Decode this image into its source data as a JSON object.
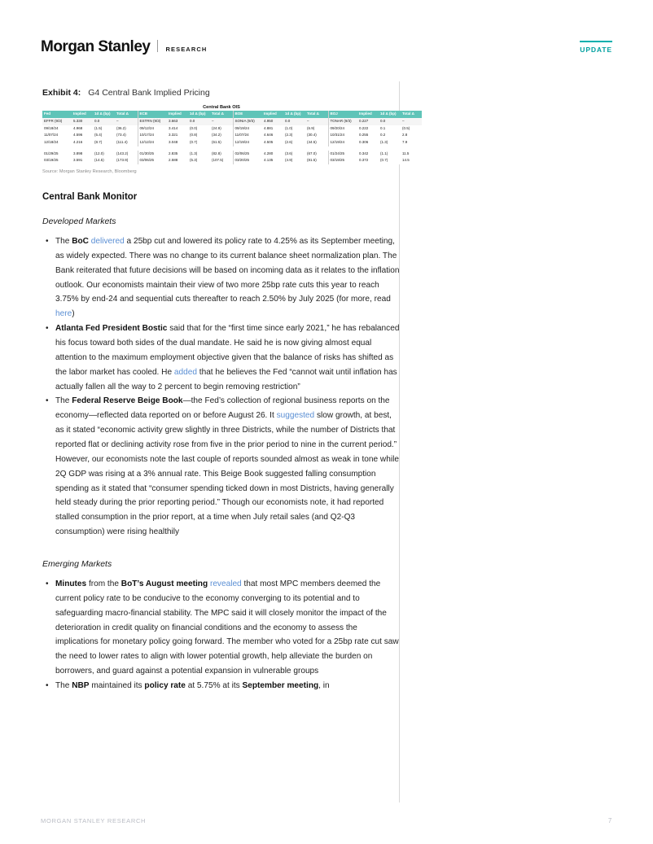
{
  "header": {
    "brand_name": "Morgan Stanley",
    "brand_sub": "RESEARCH",
    "update_badge": "UPDATE",
    "accent_color": "#00b0ae"
  },
  "exhibit": {
    "label": "Exhibit 4:",
    "title": "G4 Central Bank Implied Pricing",
    "table_supertitle": "Central Bank OIS",
    "source": "Source: Morgan Stanley Research, Bloomberg",
    "headers": [
      "Fed",
      "Implied",
      "1d Δ (bp)",
      "Total Δ",
      "ECB",
      "Implied",
      "1d Δ (bp)",
      "Total Δ",
      "BOE",
      "Implied",
      "1d Δ (bp)",
      "Total Δ",
      "BOJ",
      "Implied",
      "1d Δ (bp)",
      "Total Δ"
    ],
    "rows": [
      {
        "shade": true,
        "cells": [
          "EFFR (9/3)",
          "5.330",
          "0.0",
          "–",
          "ESTRN (9/3)",
          "3.663",
          "0.0",
          "–",
          "SONIA (9/3)",
          "4.950",
          "0.0",
          "–",
          "TONAR (9/3)",
          "0.227",
          "0.0",
          "–"
        ],
        "neg": [
          false,
          false,
          false,
          false,
          false,
          false,
          false,
          false,
          false,
          false,
          false,
          false,
          false,
          false,
          false,
          false
        ]
      },
      {
        "shade": false,
        "cells": [
          "09/18/24",
          "4.968",
          "(1.5)",
          "(36.2)",
          "09/12/24",
          "3.414",
          "(0.0)",
          "(24.9)",
          "09/19/24",
          "4.881",
          "(1.0)",
          "(6.9)",
          "09/20/24",
          "0.222",
          "0.1",
          "(0.5)"
        ],
        "neg": [
          false,
          false,
          true,
          true,
          false,
          false,
          true,
          true,
          false,
          false,
          true,
          true,
          false,
          false,
          false,
          true
        ]
      },
      {
        "shade": false,
        "cells": [
          "11/07/24",
          "4.596",
          "(5.4)",
          "(73.4)",
          "10/17/24",
          "3.321",
          "(0.8)",
          "(34.2)",
          "11/07/24",
          "4.646",
          "(2.3)",
          "(30.4)",
          "10/31/24",
          "0.255",
          "0.2",
          "2.8"
        ],
        "neg": [
          false,
          false,
          true,
          true,
          false,
          false,
          true,
          true,
          false,
          false,
          true,
          true,
          false,
          false,
          false,
          false
        ]
      },
      {
        "shade": false,
        "cells": [
          "12/18/24",
          "4.216",
          "(8.7)",
          "(111.4)",
          "12/12/24",
          "3.048",
          "(0.7)",
          "(61.5)",
          "12/19/24",
          "4.505",
          "(2.6)",
          "(44.5)",
          "12/19/24",
          "0.306",
          "(1.3)",
          "7.9"
        ],
        "neg": [
          false,
          false,
          true,
          true,
          false,
          false,
          true,
          true,
          false,
          false,
          true,
          true,
          false,
          false,
          true,
          false
        ]
      },
      {
        "shade": false,
        "cells": [
          "01/29/25",
          "3.898",
          "(12.0)",
          "(143.2)",
          "01/30/25",
          "2.835",
          "(1.3)",
          "(82.8)",
          "02/06/25",
          "4.280",
          "(3.6)",
          "(67.0)",
          "01/24/25",
          "0.342",
          "(1.1)",
          "11.5"
        ],
        "neg": [
          false,
          false,
          true,
          true,
          false,
          false,
          true,
          true,
          false,
          false,
          true,
          true,
          false,
          false,
          true,
          false
        ]
      },
      {
        "shade": false,
        "cells": [
          "03/19/25",
          "3.591",
          "(14.5)",
          "(173.9)",
          "03/06/25",
          "2.588",
          "(5.3)",
          "(107.5)",
          "03/20/25",
          "4.135",
          "(4.9)",
          "(81.5)",
          "03/19/25",
          "0.372",
          "(0.7)",
          "14.5"
        ],
        "neg": [
          false,
          false,
          true,
          true,
          false,
          false,
          true,
          true,
          false,
          false,
          true,
          true,
          false,
          false,
          true,
          false
        ]
      }
    ]
  },
  "body": {
    "section_title": "Central Bank Monitor",
    "dm_heading": "Developed Markets",
    "em_heading": "Emerging Markets",
    "dm_bullets": [
      {
        "parts": [
          {
            "t": "The ",
            "s": "n"
          },
          {
            "t": "BoC",
            "s": "b"
          },
          {
            "t": " ",
            "s": "n"
          },
          {
            "t": "delivered",
            "s": "l"
          },
          {
            "t": " a 25bp cut and lowered its policy rate to 4.25% as its September meeting, as widely expected. There was no change to its current balance sheet normalization plan. The Bank reiterated that future decisions will be based on incoming data as it relates to the inflation outlook. Our economists maintain their view of two more 25bp rate cuts this year to reach 3.75% by end-24 and sequential cuts thereafter to reach 2.50% by July 2025 (for more, read ",
            "s": "n"
          },
          {
            "t": "here",
            "s": "l"
          },
          {
            "t": ")",
            "s": "n"
          }
        ]
      },
      {
        "parts": [
          {
            "t": "Atlanta Fed President Bostic",
            "s": "b"
          },
          {
            "t": " said that for the “first time since early 2021,” he has rebalanced his focus toward both sides of the dual mandate. He said he is now giving almost equal attention to the maximum employment objective given that the balance of risks has shifted as the labor market has cooled. He ",
            "s": "n"
          },
          {
            "t": "added",
            "s": "l"
          },
          {
            "t": " that he believes the Fed “cannot wait until inflation has actually fallen all the way to 2 percent to begin removing restriction”",
            "s": "n"
          }
        ]
      },
      {
        "parts": [
          {
            "t": "The ",
            "s": "n"
          },
          {
            "t": "Federal Reserve Beige Book",
            "s": "b"
          },
          {
            "t": "—the Fed’s collection of regional business reports on the economy—reflected data reported on or before August 26. It ",
            "s": "n"
          },
          {
            "t": "suggested",
            "s": "l"
          },
          {
            "t": " slow growth, at best, as it stated “economic activity grew slightly in three Districts, while the number of Districts that reported flat or declining activity rose from five in the prior period to nine in the current period.” However, our economists note the last couple of reports sounded almost as weak in tone while 2Q GDP was rising at a 3% annual rate. This Beige Book suggested falling consumption spending as it stated that “consumer spending ticked down in most Districts, having generally held steady during the prior reporting period.” Though our economists note, it had reported stalled consumption in the prior report, at a time when July retail sales (and Q2-Q3 consumption) were rising healthily",
            "s": "n"
          }
        ]
      }
    ],
    "em_bullets": [
      {
        "parts": [
          {
            "t": "Minutes",
            "s": "b"
          },
          {
            "t": " from the ",
            "s": "n"
          },
          {
            "t": "BoT’s August meeting",
            "s": "b"
          },
          {
            "t": " ",
            "s": "n"
          },
          {
            "t": "revealed",
            "s": "l"
          },
          {
            "t": " that most MPC members deemed the current policy rate to be conducive to the economy converging to its potential and to safeguarding macro-financial stability. The MPC said it will closely monitor the impact of the deterioration in credit quality on financial conditions and the economy to assess the implications for monetary policy going forward. The member who voted for a 25bp rate cut saw the need to lower rates to align with lower potential growth, help alleviate the burden on borrowers, and guard against a potential expansion in vulnerable groups",
            "s": "n"
          }
        ]
      },
      {
        "parts": [
          {
            "t": "The ",
            "s": "n"
          },
          {
            "t": "NBP",
            "s": "b"
          },
          {
            "t": " maintained its ",
            "s": "n"
          },
          {
            "t": "policy rate",
            "s": "b"
          },
          {
            "t": " at 5.75% at its ",
            "s": "n"
          },
          {
            "t": "September meeting",
            "s": "b"
          },
          {
            "t": ", in",
            "s": "n"
          }
        ]
      }
    ]
  },
  "footer": {
    "left": "MORGAN STANLEY RESEARCH",
    "page_number": "7"
  }
}
